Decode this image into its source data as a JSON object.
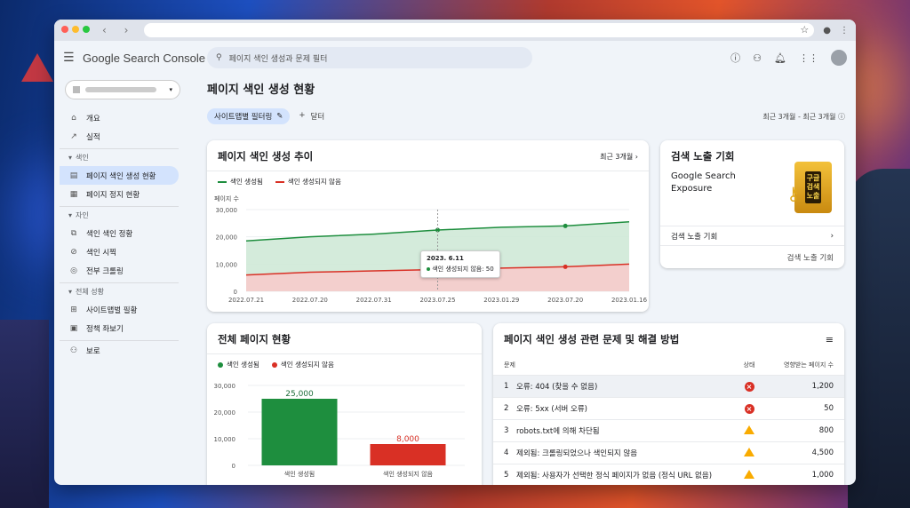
{
  "app": {
    "logo_text": "Google Search Console",
    "search_placeholder": "페이지 색인 생성과 문제 필터"
  },
  "sidebar": {
    "items_top": [
      {
        "label": "개요",
        "icon": "home-icon"
      },
      {
        "label": "실적",
        "icon": "trending-icon"
      }
    ],
    "section_index": "색인",
    "items_index": [
      {
        "label": "페이지 색인 생성 현황",
        "icon": "page-icon",
        "active": true
      },
      {
        "label": "페이지 정지 현황",
        "icon": "table-icon"
      }
    ],
    "section_exp": "자인",
    "items_exp": [
      {
        "label": "색인 색인 정황",
        "icon": "copy-icon"
      },
      {
        "label": "색인 시찍",
        "icon": "no-index-icon"
      },
      {
        "label": "전부 크롤링",
        "icon": "hidden-icon"
      }
    ],
    "section_all": "전체 성황",
    "items_all": [
      {
        "label": "사이트맵벌 필황",
        "icon": "sitemap-icon"
      },
      {
        "label": "정책 좌보기",
        "icon": "report-icon"
      }
    ],
    "item_last": {
      "label": "보로",
      "icon": "users-icon"
    }
  },
  "main": {
    "title": "페이지 색인 생성 현황",
    "filter_chip": "사이트맵별 필터링",
    "add_filter": "달터",
    "date_range": "최근 3개월 - 최근 3개월"
  },
  "trend_card": {
    "title": "페이지 색인 생성 추이",
    "range_link": "최근 3개월",
    "legend": [
      "색인 생성됨",
      "색인 생성되지 않음"
    ],
    "ylabel": "페이지 수",
    "tooltip_date": "2023. 6.11",
    "tooltip_text": "색인 생성되지 않음: 50"
  },
  "exposure_card": {
    "title": "검색 노출 기회",
    "body": "Google Search Exposure",
    "badge": "구글\n검색\n노출",
    "link": "검색 노출 기회",
    "footer": "검색 노출 기회"
  },
  "overall_card": {
    "title": "전체 페이지 현황",
    "legend": [
      "색인 생성됨",
      "색인 생성되지 않음"
    ]
  },
  "issues_card": {
    "title": "페이지 색인 생성 관련 문제 및 해결 방법",
    "headers": {
      "issue": "문제",
      "status": "상태",
      "count": "영향받는 페이지 수"
    },
    "rows": [
      {
        "n": "1",
        "text": "오류: 404 (찾을 수 없음)",
        "status": "error",
        "count": "1,200"
      },
      {
        "n": "2",
        "text": "오류: 5xx (서버 오류)",
        "status": "error",
        "count": "50"
      },
      {
        "n": "3",
        "text": "robots.txt에 의해 차단됨",
        "status": "warning",
        "count": "800"
      },
      {
        "n": "4",
        "text": "제외됨: 크롤링되었으나 색인되지 않음",
        "status": "warning",
        "count": "4,500"
      },
      {
        "n": "5",
        "text": "제외됨: 사용자가 선택한 정식 페이지가 없음 (정식 URL 없음)",
        "status": "warning",
        "count": "1,000"
      }
    ]
  },
  "colors": {
    "indexed": "#1e8e3e",
    "not_indexed": "#d93025",
    "indexed_fill": "#cfe9d7",
    "not_indexed_fill": "#f6cccb"
  },
  "chart_data": [
    {
      "type": "area",
      "title": "페이지 색인 생성 추이",
      "ylabel": "페이지 수",
      "ylim": [
        0,
        30000
      ],
      "yticks": [
        "0",
        "10,000",
        "20,000",
        "30,000"
      ],
      "x": [
        "2022.07.21",
        "2022.07.20",
        "2022.07.31",
        "2023.07.25",
        "2023.01.29",
        "2023.07.20",
        "2023.01.16"
      ],
      "series": [
        {
          "name": "색인 생성됨",
          "values": [
            18500,
            20000,
            21000,
            22500,
            23500,
            24000,
            25500
          ]
        },
        {
          "name": "색인 생성되지 않음",
          "values": [
            6000,
            7000,
            7500,
            8000,
            8500,
            9000,
            10000
          ]
        }
      ]
    },
    {
      "type": "bar",
      "title": "전체 페이지 현황",
      "categories": [
        "색인 생성됨",
        "색인 생성되지 않음"
      ],
      "values": [
        25000,
        8000
      ],
      "value_labels": [
        "25,000",
        "8,000"
      ],
      "ylim": [
        0,
        30000
      ],
      "yticks": [
        "0",
        "10,000",
        "20,000",
        "30,000"
      ]
    }
  ]
}
